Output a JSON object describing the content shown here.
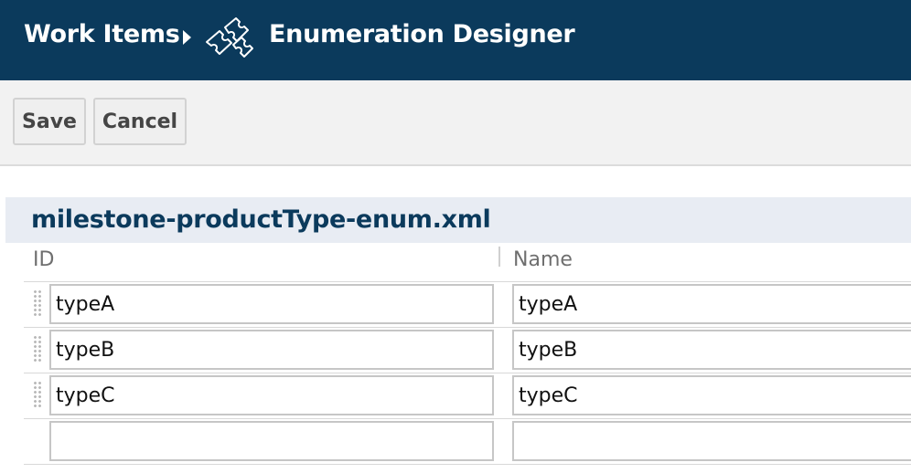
{
  "header": {
    "breadcrumb_root": "Work Items",
    "breadcrumb_current": "Enumeration Designer",
    "icon": "puzzle-piece-icon",
    "background": "#0b3a5c"
  },
  "toolbar": {
    "save_label": "Save",
    "cancel_label": "Cancel"
  },
  "panel": {
    "title": "milestone-productType-enum.xml",
    "columns": {
      "id": "ID",
      "name": "Name"
    },
    "rows": [
      {
        "id": "typeA",
        "name": "typeA"
      },
      {
        "id": "typeB",
        "name": "typeB"
      },
      {
        "id": "typeC",
        "name": "typeC"
      },
      {
        "id": "",
        "name": ""
      }
    ]
  }
}
